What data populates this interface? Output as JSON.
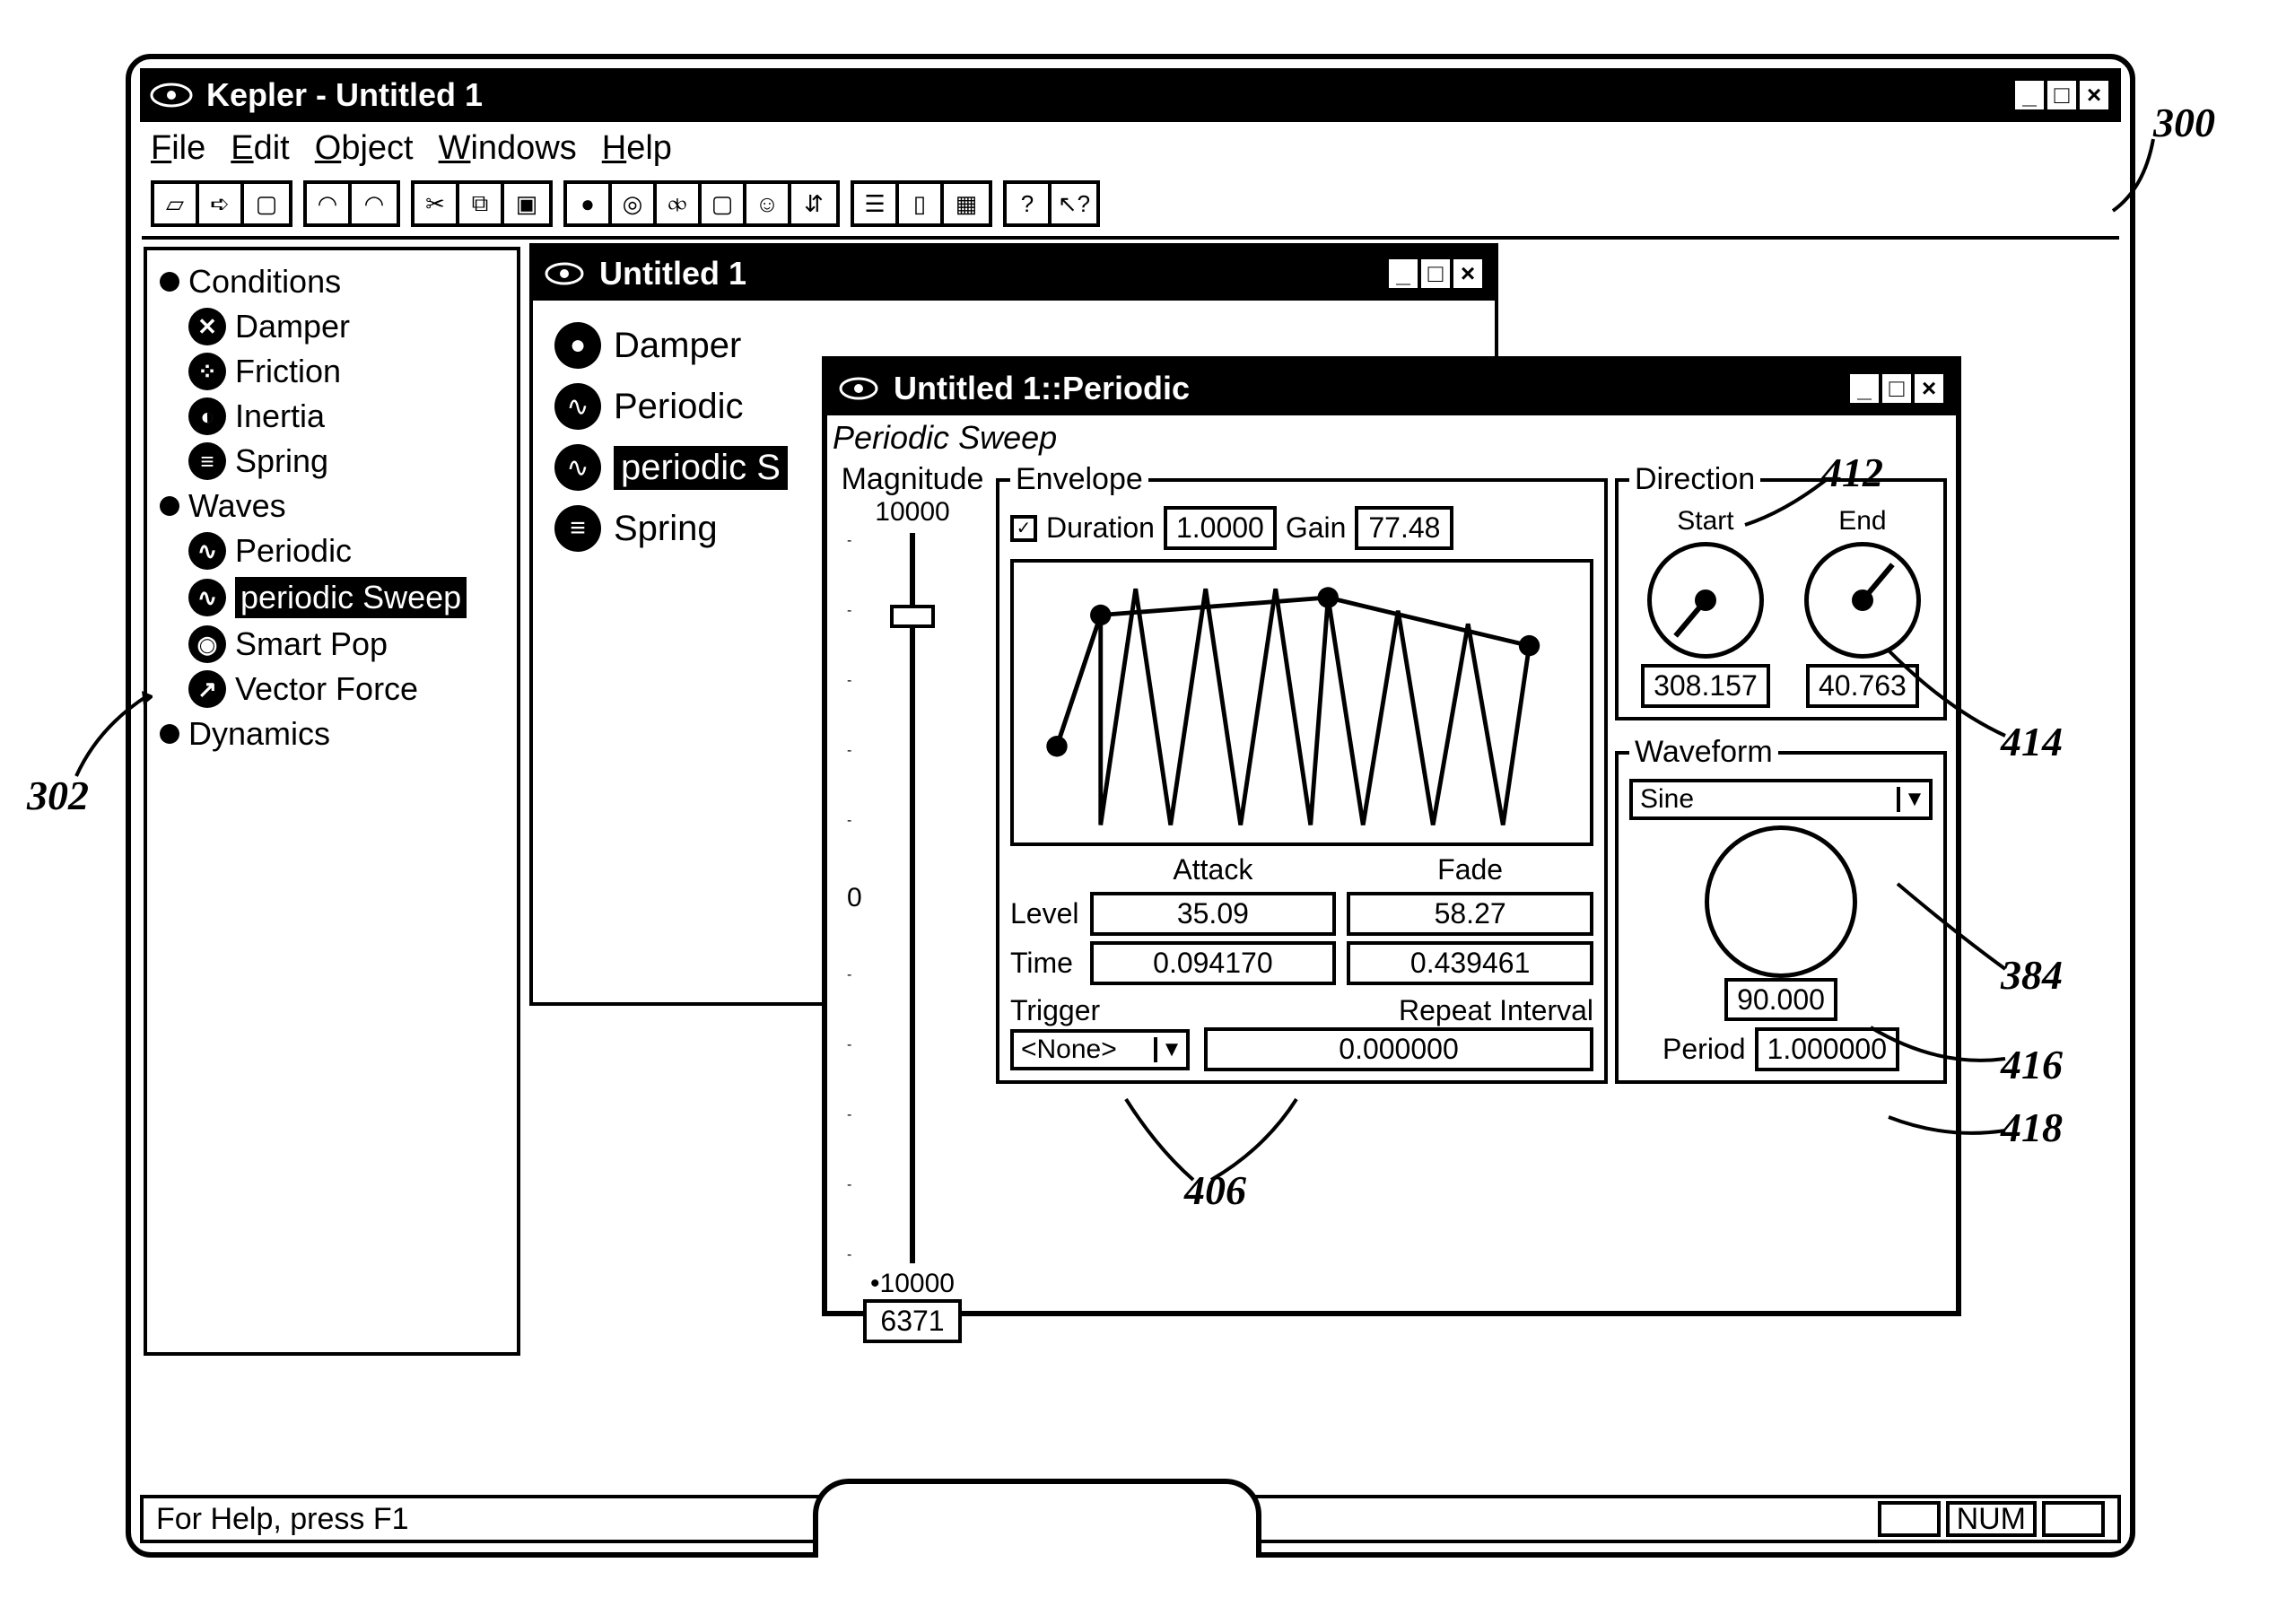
{
  "app": {
    "title": "Kepler - Untitled 1"
  },
  "menu": {
    "file": "File",
    "edit": "Edit",
    "object": "Object",
    "windows": "Windows",
    "help": "Help"
  },
  "tree": {
    "cat1": "Conditions",
    "damper": "Damper",
    "friction": "Friction",
    "inertia": "Inertia",
    "spring": "Spring",
    "cat2": "Waves",
    "periodic": "Periodic",
    "psweep": "periodic Sweep",
    "smartpop": "Smart Pop",
    "vforce": "Vector Force",
    "cat3": "Dynamics"
  },
  "win1": {
    "title": "Untitled 1",
    "items": {
      "damper": "Damper",
      "periodic": "Periodic",
      "psweep": "periodic S",
      "spring": "Spring"
    }
  },
  "win2": {
    "title": "Untitled 1::Periodic",
    "subtitle": "Periodic Sweep",
    "magnitude": {
      "label": "Magnitude",
      "max": "10000",
      "zero": "0",
      "min": "•10000",
      "value": "6371"
    },
    "envelope": {
      "legend": "Envelope",
      "duration_label": "Duration",
      "duration": "1.0000",
      "gain_label": "Gain",
      "gain": "77.48",
      "attack": "Attack",
      "fade": "Fade",
      "level_label": "Level",
      "time_label": "Time",
      "attack_level": "35.09",
      "fade_level": "58.27",
      "attack_time": "0.094170",
      "fade_time": "0.439461",
      "trigger_label": "Trigger",
      "trigger_value": "<None>",
      "repeat_label": "Repeat Interval",
      "repeat_value": "0.000000"
    },
    "direction": {
      "legend": "Direction",
      "start": "Start",
      "end": "End",
      "start_val": "308.157",
      "end_val": "40.763"
    },
    "waveform": {
      "legend": "Waveform",
      "type": "Sine",
      "phase": "90.000",
      "period_label": "Period",
      "period": "1.000000"
    }
  },
  "status": {
    "help": "For Help, press F1",
    "num": "NUM"
  },
  "callouts": {
    "c300": "300",
    "c302": "302",
    "c406": "406",
    "c412": "412",
    "c414": "414",
    "c384": "384",
    "c416": "416",
    "c418": "418"
  }
}
